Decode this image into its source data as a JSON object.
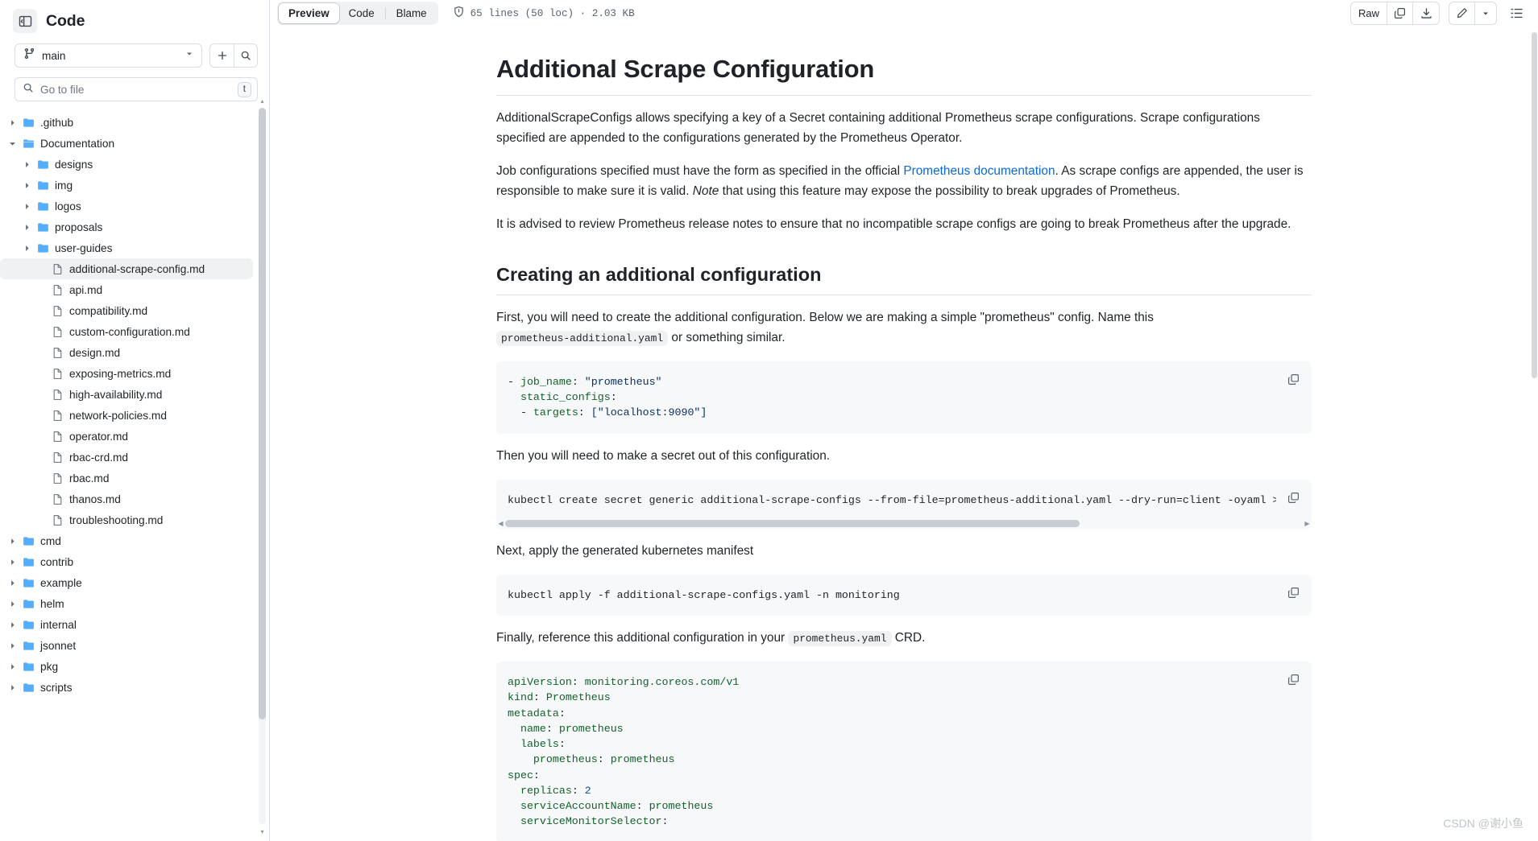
{
  "sidebar": {
    "title": "Code",
    "panel_toggle_icon": "sidebar-collapse-icon",
    "branch": {
      "value": "main",
      "icon": "git-branch-icon",
      "caret": "chevron-down-icon"
    },
    "add_button_icon": "plus-icon",
    "search_button_icon": "search-icon",
    "file_search": {
      "placeholder": "Go to file",
      "icon": "search-icon",
      "shortcut": "t"
    },
    "tree": [
      {
        "label": ".github",
        "type": "folder",
        "depth": 0,
        "expanded": false,
        "selected": false
      },
      {
        "label": "Documentation",
        "type": "folder",
        "depth": 0,
        "expanded": true,
        "selected": false
      },
      {
        "label": "designs",
        "type": "folder",
        "depth": 1,
        "expanded": false,
        "selected": false
      },
      {
        "label": "img",
        "type": "folder",
        "depth": 1,
        "expanded": false,
        "selected": false
      },
      {
        "label": "logos",
        "type": "folder",
        "depth": 1,
        "expanded": false,
        "selected": false
      },
      {
        "label": "proposals",
        "type": "folder",
        "depth": 1,
        "expanded": false,
        "selected": false
      },
      {
        "label": "user-guides",
        "type": "folder",
        "depth": 1,
        "expanded": false,
        "selected": false
      },
      {
        "label": "additional-scrape-config.md",
        "type": "file",
        "depth": 2,
        "expanded": false,
        "selected": true
      },
      {
        "label": "api.md",
        "type": "file",
        "depth": 2,
        "expanded": false,
        "selected": false
      },
      {
        "label": "compatibility.md",
        "type": "file",
        "depth": 2,
        "expanded": false,
        "selected": false
      },
      {
        "label": "custom-configuration.md",
        "type": "file",
        "depth": 2,
        "expanded": false,
        "selected": false
      },
      {
        "label": "design.md",
        "type": "file",
        "depth": 2,
        "expanded": false,
        "selected": false
      },
      {
        "label": "exposing-metrics.md",
        "type": "file",
        "depth": 2,
        "expanded": false,
        "selected": false
      },
      {
        "label": "high-availability.md",
        "type": "file",
        "depth": 2,
        "expanded": false,
        "selected": false
      },
      {
        "label": "network-policies.md",
        "type": "file",
        "depth": 2,
        "expanded": false,
        "selected": false
      },
      {
        "label": "operator.md",
        "type": "file",
        "depth": 2,
        "expanded": false,
        "selected": false
      },
      {
        "label": "rbac-crd.md",
        "type": "file",
        "depth": 2,
        "expanded": false,
        "selected": false
      },
      {
        "label": "rbac.md",
        "type": "file",
        "depth": 2,
        "expanded": false,
        "selected": false
      },
      {
        "label": "thanos.md",
        "type": "file",
        "depth": 2,
        "expanded": false,
        "selected": false
      },
      {
        "label": "troubleshooting.md",
        "type": "file",
        "depth": 2,
        "expanded": false,
        "selected": false
      },
      {
        "label": "cmd",
        "type": "folder",
        "depth": 0,
        "expanded": false,
        "selected": false
      },
      {
        "label": "contrib",
        "type": "folder",
        "depth": 0,
        "expanded": false,
        "selected": false
      },
      {
        "label": "example",
        "type": "folder",
        "depth": 0,
        "expanded": false,
        "selected": false
      },
      {
        "label": "helm",
        "type": "folder",
        "depth": 0,
        "expanded": false,
        "selected": false
      },
      {
        "label": "internal",
        "type": "folder",
        "depth": 0,
        "expanded": false,
        "selected": false
      },
      {
        "label": "jsonnet",
        "type": "folder",
        "depth": 0,
        "expanded": false,
        "selected": false
      },
      {
        "label": "pkg",
        "type": "folder",
        "depth": 0,
        "expanded": false,
        "selected": false
      },
      {
        "label": "scripts",
        "type": "folder",
        "depth": 0,
        "expanded": false,
        "selected": false
      }
    ]
  },
  "toolbar": {
    "tabs": [
      {
        "label": "Preview",
        "active": true
      },
      {
        "label": "Code",
        "active": false
      },
      {
        "label": "Blame",
        "active": false
      }
    ],
    "shield_icon": "shield-icon",
    "stats": "65 lines (50 loc) · 2.03 KB",
    "raw_label": "Raw",
    "copy_icon": "copy-icon",
    "download_icon": "download-icon",
    "edit_icon": "pencil-icon",
    "caret_icon": "chevron-down-icon",
    "outline_icon": "list-outline-icon"
  },
  "document": {
    "h1": "Additional Scrape Configuration",
    "p1": "AdditionalScrapeConfigs allows specifying a key of a Secret containing additional Prometheus scrape configurations. Scrape configurations specified are appended to the configurations generated by the Prometheus Operator.",
    "p2_a": "Job configurations specified must have the form as specified in the official ",
    "p2_link": "Prometheus documentation",
    "p2_b": ". As scrape configs are appended, the user is responsible to make sure it is valid. ",
    "p2_em": "Note",
    "p2_c": " that using this feature may expose the possibility to break upgrades of Prometheus.",
    "p3": "It is advised to review Prometheus release notes to ensure that no incompatible scrape configs are going to break Prometheus after the upgrade.",
    "h2": "Creating an additional configuration",
    "p4_a": "First, you will need to create the additional configuration. Below we are making a simple \"prometheus\" config. Name this ",
    "p4_code": "prometheus-additional.yaml",
    "p4_b": " or something similar.",
    "code1_lines": [
      "- job_name: \"prometheus\"",
      "  static_configs:",
      "  - targets: [\"localhost:9090\"]"
    ],
    "p5": "Then you will need to make a secret out of this configuration.",
    "code2": "kubectl create secret generic additional-scrape-configs --from-file=prometheus-additional.yaml --dry-run=client -oyaml > additional-scrape-configs.yaml",
    "p6": "Next, apply the generated kubernetes manifest",
    "code3": "kubectl apply -f additional-scrape-configs.yaml -n monitoring",
    "p7_a": "Finally, reference this additional configuration in your ",
    "p7_code": "prometheus.yaml",
    "p7_b": " CRD.",
    "code4_lines": [
      "apiVersion: monitoring.coreos.com/v1",
      "kind: Prometheus",
      "metadata:",
      "  name: prometheus",
      "  labels:",
      "    prometheus: prometheus",
      "spec:",
      "  replicas: 2",
      "  serviceAccountName: prometheus",
      "  serviceMonitorSelector:"
    ]
  },
  "watermark": "CSDN @谢小鱼",
  "colors": {
    "accent": "#0969da",
    "border": "#d8dee4",
    "code_bg": "#f6f8fa",
    "text": "#1f2328",
    "muted": "#59636e",
    "folder": "#54aeff"
  }
}
